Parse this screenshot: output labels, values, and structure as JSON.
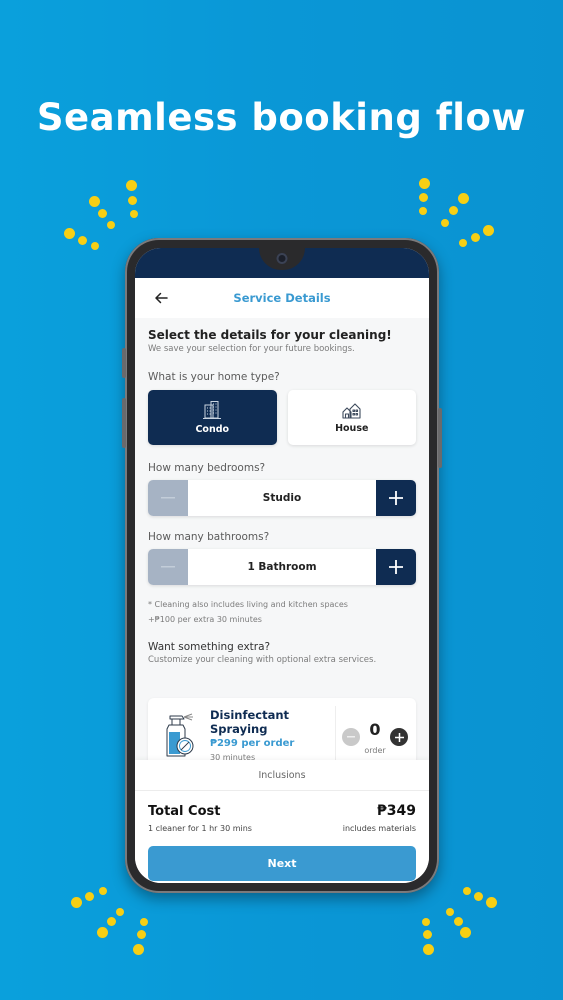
{
  "banner": {
    "headline": "Seamless booking flow"
  },
  "app": {
    "title": "Service Details",
    "intro": {
      "heading": "Select the details for your cleaning!",
      "subtext": "We save your selection for your future bookings."
    },
    "home_type": {
      "question": "What is your home type?",
      "options": [
        {
          "label": "Condo",
          "icon": "condo-building-icon",
          "selected": true
        },
        {
          "label": "House",
          "icon": "house-icon",
          "selected": false
        }
      ]
    },
    "bedrooms": {
      "question": "How many bedrooms?",
      "value": "Studio"
    },
    "bathrooms": {
      "question": "How many bathrooms?",
      "value": "1 Bathroom"
    },
    "notes": [
      "* Cleaning also includes living and kitchen spaces",
      "+₱100 per extra 30 minutes"
    ],
    "extras": {
      "heading": "Want something extra?",
      "subtext": "Customize your cleaning with optional extra services.",
      "items": [
        {
          "name": "Disinfectant Spraying",
          "name_line1": "Disinfectant",
          "name_line2": "Spraying",
          "price": "₱299 per order",
          "duration": "30 minutes",
          "quantity": "0",
          "unit": "order",
          "icon": "spray-bottle-icon"
        }
      ]
    },
    "inclusions_label": "Inclusions",
    "total": {
      "label": "Total Cost",
      "detail": "1 cleaner for 1 hr 30 mins",
      "amount": "₱349",
      "note": "includes materials"
    },
    "next_label": "Next"
  },
  "colors": {
    "background": "#0a9ad8",
    "navy": "#0f2c52",
    "accent_blue": "#3a9ad1",
    "dot_yellow": "#f7cf14"
  }
}
